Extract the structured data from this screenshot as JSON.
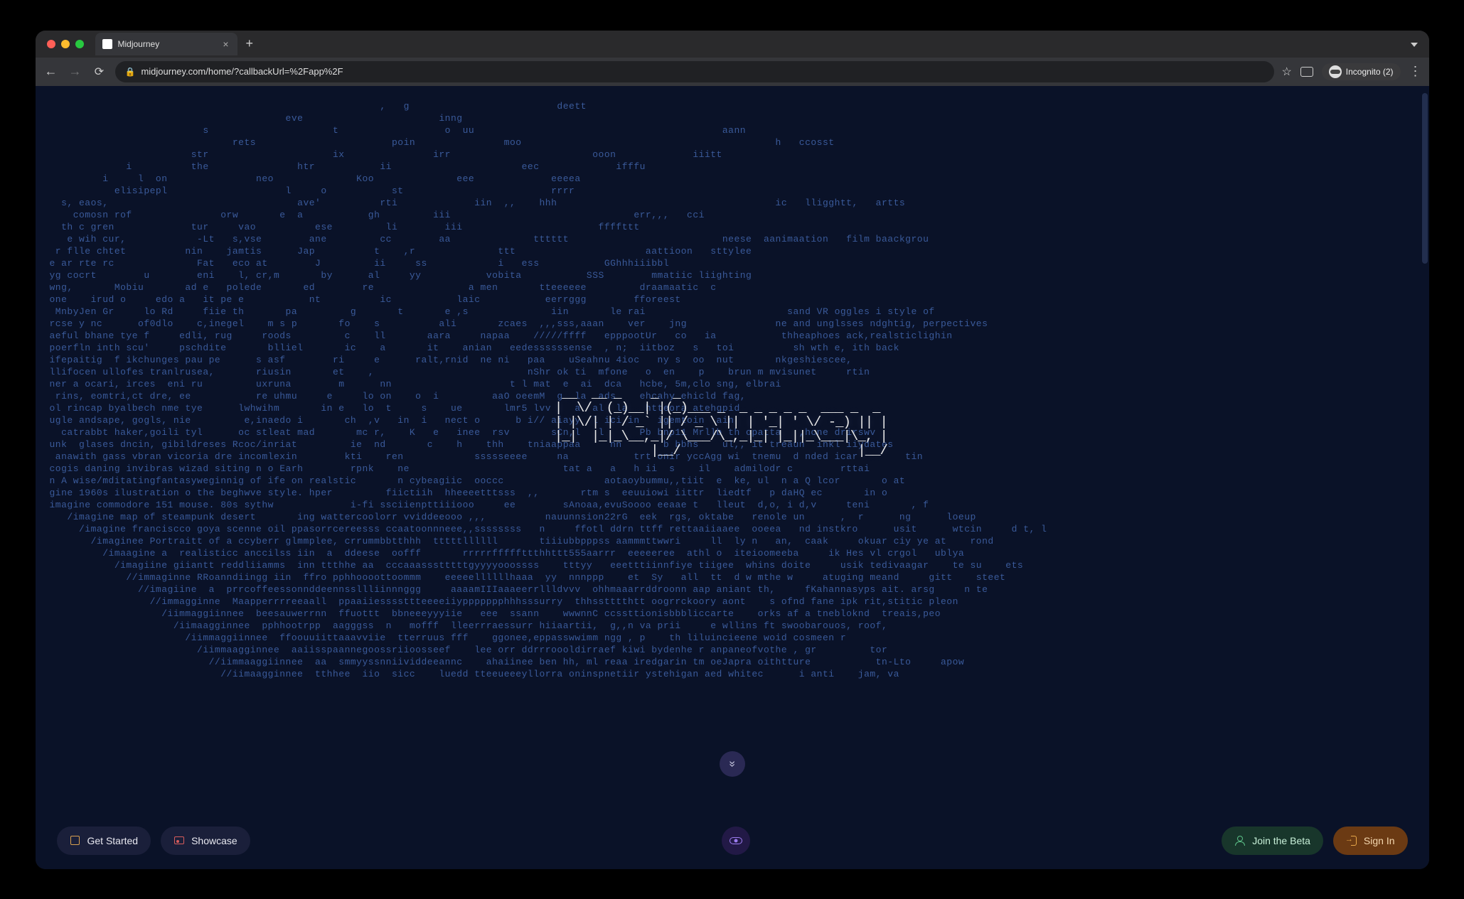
{
  "browser": {
    "tab_title": "Midjourney",
    "url": "midjourney.com/home/?callbackUrl=%2Fapp%2F",
    "incognito_label": "Incognito (2)"
  },
  "ascii_logo": " __  __ _    _  _                               \n|  \\/  (_)__| |(_)___ _  _ _ _ _ _  ___ _  _ \n| |\\/| | / _` || / _ \\ || | '_| ' \\/ -_) || |\n|_|  |_|_\\__,_|/ \\___/\\_,_|_| |_||_\\___|\\_, |\n             |__/                        |__/ ",
  "ascii_lines": [
    "                                                        ,   g                         deett",
    "                                        eve                       inng",
    "                          s                     t                  o  uu                                          aann",
    "                               rets                       poin               moo                                           h   ccosst",
    "                        str                     ix               irr                        ooon             iiitt",
    "             i          the               htr           ii                      eec             ifffu",
    "         i     l  on               neo              Koo              eee             eeeea",
    "           elisipepl                    l     o           st                         rrrr",
    "  s, eaos,                                ave'          rti             iin  ,,    hhh                                     ic   lligghtt,   artts",
    "    comosn rof               orw       e  a           gh         iii                               err,,,   cci",
    "  th c gren             tur     vao          ese         li        iii                       ffffttt",
    "   e wih cur,            -Lt   s,vse        ane         cc        aa              tttttt                          neese  aanimaation   film baackgrou",
    " r flle chtet          nin    jamtis      Jap          t    ,r              ttt                      aattioon   sttylee",
    "e ar rte rc              Fat   eco at        J         ii     ss            i   ess           GGhhhiiibbl",
    "yg cocrt        u        eni    l, cr,m       by      al     yy           vobita           SSS        mmatiic liighting",
    "wng,       Mobiu       ad e   polede       ed        re                a men       tteeeeee         draamaatic  c",
    "one    irud o     edo a   it pe e           nt          ic           laic           eerrggg        fforeest",
    " MnbyJen Gr     lo Rd     fiie th       pa         g       t       e ,s              iin       le rai                        sand VR oggles i style of",
    "rcse y nc      of0dlo    c,inegel    m s p       fo    s          ali       zcaes  ,,,sss,aaan    ver    jng               ne and unglsses ndghtig, perpectives",
    "aeful bhane tye f     edli, rug     roods         c    ll       aara     napaa    /////ffff   epppootUr   co   ia           thheaphoes ack,realsticlighin",
    "poerfln inth scu'     pschdite       blliel       ic    a       it    anian   eedessssssense  , n;  iitboz   s   toi          sh wth e, ith back",
    "ifepaitig  f ikchunges pau pe      s asf        ri     e      ralt,rnid  ne ni   paa    uSeahnu 4ioc   ny s  oo  nut       nkgeshiescee,",
    "llifocen ullofes tranlrusea,       riusin       et    ,                          nShr ok ti  mfone   o  en    p    brun m mvisunet     rtin",
    "ner a ocari, irces  eni ru         uxruna        m      nn                    t l mat  e  ai  dca   hcbe, 5m,clo sng, elbrai",
    " rins, eomtri,ct dre, ee           re uhmu     e     lo on    o  i         aaO oeemM  g  la  ads    ehcahy ehicld fag,",
    "ol rincap byalbech nme tye      lwhwihm       in e   lo  t     s    ue       lmr5 lvv    a  al  la   htteora atehgpid",
    "ugle andsape, gogls, nie         e,inaedo i       ch  ,v   in  i   nect o      b i// aiayy  l ici in   igemtoin  ain",
    "  catrabbt haker,goili tyl      oc stleat mad       mc r,    K   e   inee  rsv       sCn,l   l      Pb bnp11 Mrllb th opatta   ,hcne drirswv",
    "unk  glases dncin, gibildreses Rcoc/inriat         ie  nd       c    h    thh    tniaappaa     nn       b bbhs    ul,, it treaun  inkl iiydates",
    " anawith gass vbran vicoria dre incomlexin        kti    ren            ssssseeee     na           trt onir yccAgg wi  tnemu  d nded icar        tin",
    "cogis daning invibras wizad siting n o Earh        rpnk    ne                          tat a   a   h ii  s    il    admilodr c        rttai",
    "n A wise/mditatingfantasyweginnig of ife on realstic       n cybeagiic  ooccc                 aotaoybummu,,tiit  e  ke, ul  n a Q lcor       o at",
    "gine 1960s ilustration o the beghwve style. hper         fiictiih  hheeeetttsss  ,,       rtm s  eeuuiowi iittr  liedtf   p daHQ ec       in o",
    "imagine commodore 151 mouse. 80s sythw             i-fi ssciienpttiiiooo     ee        sAnoaa,evuSoooo eeaae t   lleut  d,o, i d,v     teni       , f",
    "   /imagine map of steampunk desert       ing wattercoolorr vviddeeooo ,,,          nauunnsion22rG  eek  rgs, oktabe   renole un      ,  r      ng      loeup",
    "     /imagine franciscco goya scenne oil ppasorrcereesss ccaatoonnneee,,ssssssss   n     ffotl ddrn ttff rettaaiiaaee  ooeea   nd instkro      usit      wtcin     d t, l",
    "       /imaginee Portraitt of a ccyberr glmmplee, crrummbbtthhh  tttttllllll       tiiiubbpppss aammmttwwri     ll  ly n   an,  caak     okuar ciy ye at    rond",
    "         /imaagine a  realisticc anccilss iin  a  ddeese  oofff       rrrrrfffffttthhttt555aarrr  eeeeeree  athl o  iteioomeeba     ik Hes vl crgol   ublya",
    "           /imagiine giiantt reddliiamms  inn ttthhe aa  cccaaassstttttgyyyyooossss    tttyy   eeetttiinnfiye tiigee  whins doite     usik tedivaagar    te su    ets",
    "             //immaginne RRoanndiingg iin  ffro pphhoooottoommm    eeeeellllllhaaa  yy  nnnppp    et  Sy   all  tt  d w mthe w     atuging meand     gitt    steet",
    "               //imagiine  a  prrcoffeessonnddeennssllliinnnggg     aaaamIIIaaaeerrllldvvv  ohhmaaarrddroonn aap aniant th,     fKahannasyps ait. arsg     n te",
    "                 //immagginne  Maapperrrreeaall  ppaaiiessssttteeeeiiyppppppphhhsssurry  thhsstttthtt oogrrckoory aont    s ofnd fane ipk rit,stitic pleon",
    "                   /iimmaggiinnee  beesauwerrnn  ffuottt  bbneeeyyyiie   eee  ssann    wwwnnC ccssttionisbbbliccarte    orks af a tnebloknd  treais,peo",
    "                     /iimaagginnee  pphhootrpp  aagggss  n   mofff  lleerrraessurr hiiaartii,  g,,n va prii     e wllins ft swoobarouos, roof,",
    "                       /iimmaggiinnee  ffoouuiittaaavviie  tterruus fff    ggonee,eppasswwimm ngg , p    th liluincieene woid cosmeen r",
    "                         /iimmaagginnee  aaiisspaannegoossriioosseef    lee orr ddrrroooldirraef kiwi bydenhe r anpaneofvothe , gr         tor",
    "                           //iimmaaggiinnee  aa  smmyyssnniividdeeannc    ahaiinee ben hh, ml reaa iredgarin tm oeJapra oithtture           tn-Lto     apow",
    "                             //iimaagginnee  tthhee  iio  sicc    luedd tteeueeeyllorra oninspnetiir ystehigan aed whitec      i anti    jam, va"
  ],
  "buttons": {
    "get_started": "Get Started",
    "showcase": "Showcase",
    "join_beta": "Join the Beta",
    "sign_in": "Sign In"
  }
}
